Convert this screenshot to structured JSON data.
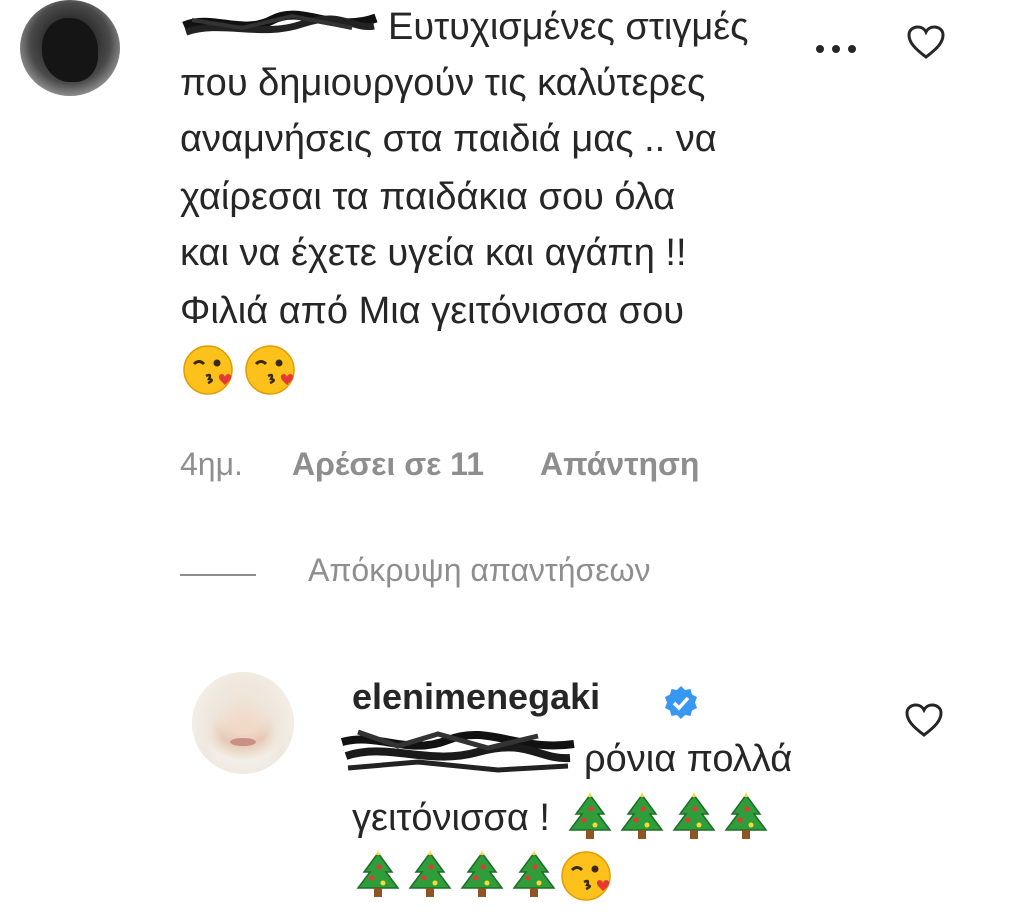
{
  "comment": {
    "lines": [
      "Ευτυχισμένες στιγμές",
      "που δημιουργούν τις καλύτερες",
      "αναμνήσεις στα παιδιά μας .. να",
      "χαίρεσαι τα παιδάκια σου όλα",
      "και να έχετε υγεία και αγάπη !!",
      "Φιλιά από Μια γειτόνισσα σου"
    ],
    "emojis": [
      "kissing-wink-emoji",
      "kissing-wink-emoji"
    ],
    "time": "4ημ.",
    "likes": "Αρέσει σε 11",
    "reply_label": "Απάντηση"
  },
  "hide_replies_label": "Απόκρυψη απαντήσεων",
  "reply": {
    "username": "elenimenegaki",
    "line1": "ρόνια πολλά",
    "line2": "γειτόνισσα !",
    "line2_emojis": [
      "christmas-tree-emoji",
      "christmas-tree-emoji",
      "christmas-tree-emoji",
      "christmas-tree-emoji"
    ],
    "line3_emojis": [
      "christmas-tree-emoji",
      "christmas-tree-emoji",
      "christmas-tree-emoji",
      "christmas-tree-emoji",
      "kissing-wink-emoji"
    ]
  },
  "colors": {
    "text": "#262626",
    "muted": "#8e8e8e",
    "verified": "#3897f0"
  }
}
